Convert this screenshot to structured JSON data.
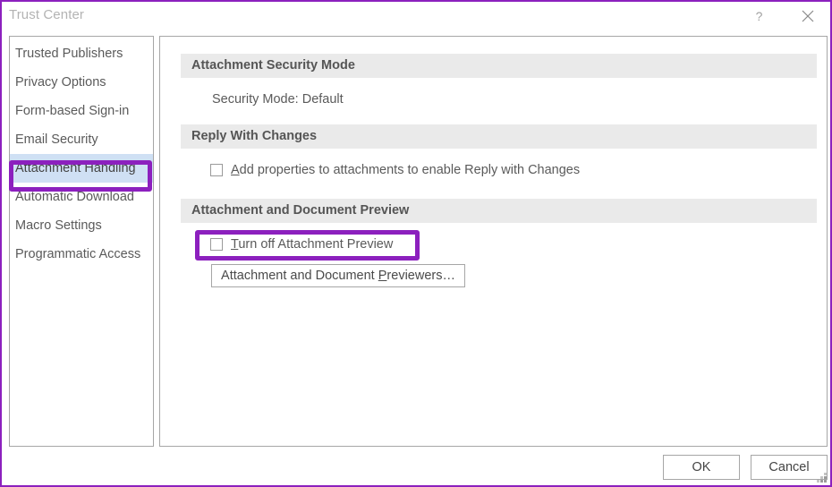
{
  "window": {
    "title": "Trust Center",
    "accent_color": "#8c20be",
    "titlebar": {
      "help_icon": "question-mark-icon",
      "close_icon": "close-icon"
    }
  },
  "sidebar": {
    "items": [
      {
        "label": "Trusted Publishers",
        "selected": false
      },
      {
        "label": "Privacy Options",
        "selected": false
      },
      {
        "label": "Form-based Sign-in",
        "selected": false
      },
      {
        "label": "Email Security",
        "selected": false
      },
      {
        "label": "Attachment Handling",
        "selected": true
      },
      {
        "label": "Automatic Download",
        "selected": false
      },
      {
        "label": "Macro Settings",
        "selected": false
      },
      {
        "label": "Programmatic Access",
        "selected": false
      }
    ],
    "selected_highlight_color": "#cfe0f4"
  },
  "main": {
    "sections": {
      "security_mode": {
        "header": "Attachment Security Mode",
        "value_text": "Security Mode: Default"
      },
      "reply_with_changes": {
        "header": "Reply With Changes",
        "checkbox": {
          "accel": "A",
          "rest": "dd properties to attachments to enable Reply with Changes",
          "checked": false
        }
      },
      "attachment_preview": {
        "header": "Attachment and Document Preview",
        "checkbox": {
          "accel": "T",
          "rest": "urn off Attachment Preview",
          "checked": false
        },
        "button": {
          "pre": "Attachment and Document ",
          "accel": "P",
          "post": "reviewers…"
        }
      }
    }
  },
  "footer": {
    "ok_label": "OK",
    "cancel_label": "Cancel",
    "resize_grip": "resize-grip-icon"
  },
  "annotations": {
    "color": "#8c20be",
    "boxes": [
      {
        "name": "sidebar-attachment-handling-highlight"
      },
      {
        "name": "turn-off-attachment-preview-highlight"
      }
    ]
  }
}
